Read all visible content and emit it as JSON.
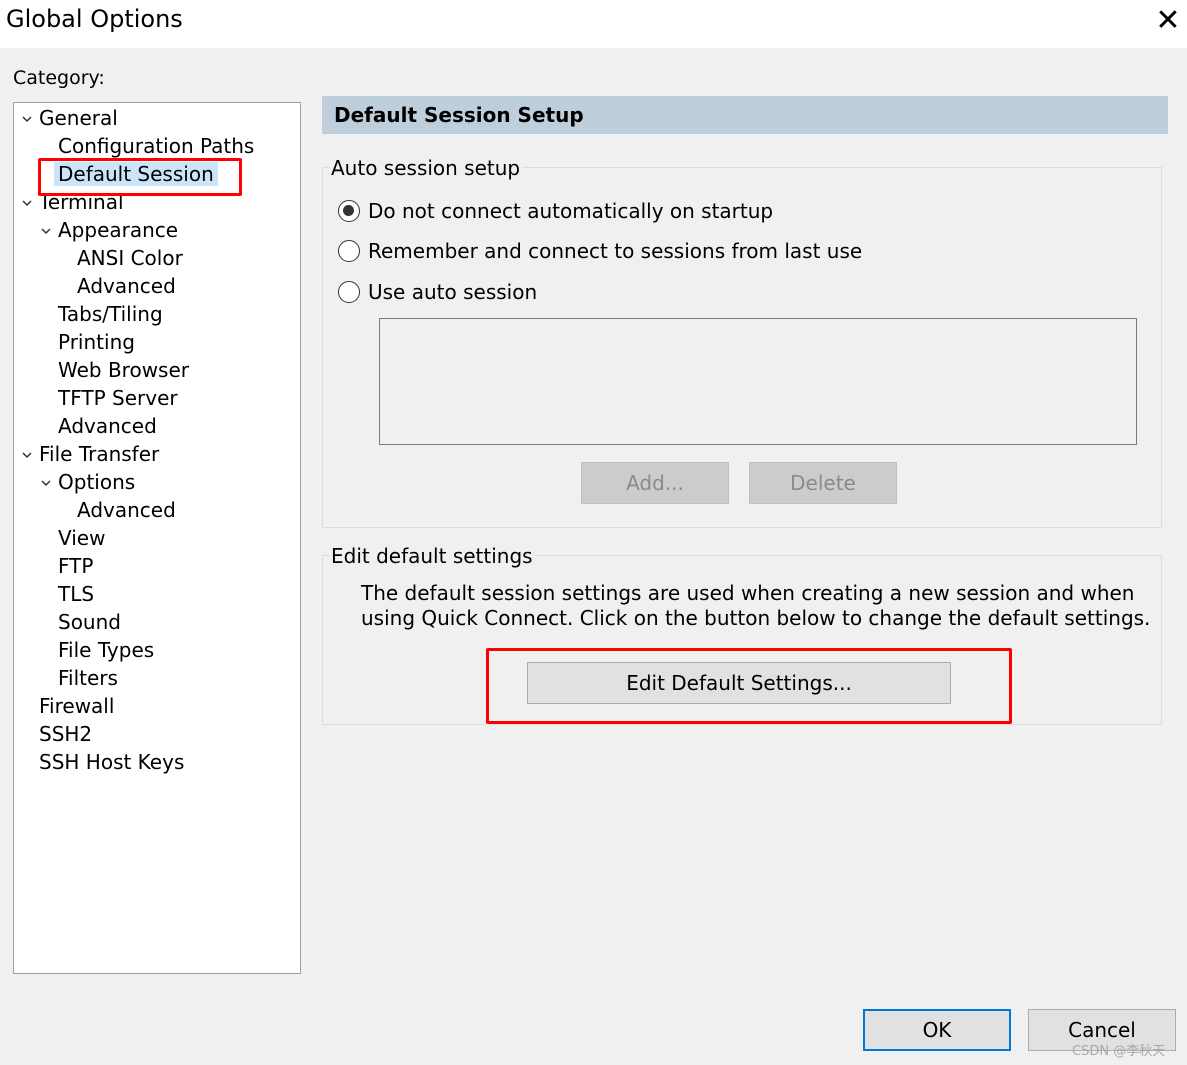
{
  "window": {
    "title": "Global Options",
    "close_glyph": "✕"
  },
  "category": {
    "label": "Category:",
    "tree": [
      {
        "label": "General",
        "expanded": true
      },
      {
        "label": "Configuration Paths"
      },
      {
        "label": "Default Session",
        "selected": true
      },
      {
        "label": "Terminal",
        "expanded": true
      },
      {
        "label": "Appearance",
        "expanded": true
      },
      {
        "label": "ANSI Color"
      },
      {
        "label": "Advanced"
      },
      {
        "label": "Tabs/Tiling"
      },
      {
        "label": "Printing"
      },
      {
        "label": "Web Browser"
      },
      {
        "label": "TFTP Server"
      },
      {
        "label": "Advanced"
      },
      {
        "label": "File Transfer",
        "expanded": true
      },
      {
        "label": "Options",
        "expanded": true
      },
      {
        "label": "Advanced"
      },
      {
        "label": "View"
      },
      {
        "label": "FTP"
      },
      {
        "label": "TLS"
      },
      {
        "label": "Sound"
      },
      {
        "label": "File Types"
      },
      {
        "label": "Filters"
      },
      {
        "label": "Firewall"
      },
      {
        "label": "SSH2"
      },
      {
        "label": "SSH Host Keys"
      }
    ]
  },
  "panel": {
    "header": "Default Session Setup",
    "auto_session": {
      "group_label": "Auto session setup",
      "options": [
        {
          "label": "Do not connect automatically on startup",
          "checked": true
        },
        {
          "label": "Remember and connect to sessions from last use",
          "checked": false
        },
        {
          "label": "Use auto session",
          "checked": false
        }
      ],
      "add_button": "Add...",
      "delete_button": "Delete"
    },
    "edit_defaults": {
      "group_label": "Edit default settings",
      "description_line1": "The default session settings are used when creating a new session and when",
      "description_line2": "using Quick Connect.  Click on the button below to change the default settings.",
      "button": "Edit Default Settings..."
    }
  },
  "footer": {
    "ok": "OK",
    "cancel": "Cancel"
  },
  "watermark": "CSDN @李秋天",
  "colors": {
    "highlight": "#ff0000",
    "selection": "#cce4f7",
    "header_band": "#bfcedb",
    "ok_border": "#0078d7"
  }
}
